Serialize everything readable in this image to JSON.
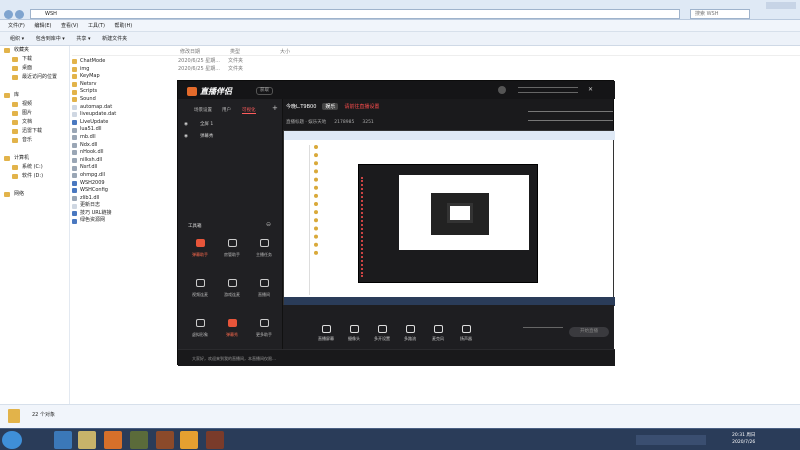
{
  "explorer": {
    "address": "WSH",
    "search_placeholder": "搜索 WSH",
    "menu": [
      "文件(F)",
      "编辑(E)",
      "查看(V)",
      "工具(T)",
      "帮助(H)"
    ],
    "toolbar": [
      "组织 ▾",
      "包含到库中 ▾",
      "共享 ▾",
      "新建文件夹"
    ],
    "columns": {
      "date": "修改日期",
      "type": "类型",
      "size": "大小"
    },
    "sidebar": [
      {
        "label": "收藏夹",
        "indent": 0
      },
      {
        "label": "下载",
        "indent": 1
      },
      {
        "label": "桌面",
        "indent": 1
      },
      {
        "label": "最近访问的位置",
        "indent": 1
      },
      {
        "label": "",
        "indent": 0
      },
      {
        "label": "库",
        "indent": 0
      },
      {
        "label": "视频",
        "indent": 1
      },
      {
        "label": "图片",
        "indent": 1
      },
      {
        "label": "文档",
        "indent": 1
      },
      {
        "label": "迅雷下载",
        "indent": 1
      },
      {
        "label": "音乐",
        "indent": 1
      },
      {
        "label": "",
        "indent": 0
      },
      {
        "label": "计算机",
        "indent": 0
      },
      {
        "label": "系统 (C:)",
        "indent": 1
      },
      {
        "label": "软件 (D:)",
        "indent": 1
      },
      {
        "label": "",
        "indent": 0
      },
      {
        "label": "网络",
        "indent": 0
      }
    ],
    "files": [
      {
        "name": "ChatMode",
        "date": "2020/6/25 星期...",
        "type": "文件夹",
        "icon": "folder"
      },
      {
        "name": "img",
        "date": "2020/6/25 星期...",
        "type": "文件夹",
        "icon": "folder"
      },
      {
        "name": "KeyMap",
        "date": "",
        "type": "",
        "icon": "folder"
      },
      {
        "name": "Netsrv",
        "date": "",
        "type": "",
        "icon": "folder"
      },
      {
        "name": "Scripts",
        "date": "",
        "type": "",
        "icon": "folder"
      },
      {
        "name": "Sound",
        "date": "",
        "type": "",
        "icon": "folder"
      },
      {
        "name": "automap.dat",
        "date": "",
        "type": "",
        "icon": "file"
      },
      {
        "name": "liveupdate.dat",
        "date": "",
        "type": "",
        "icon": "file"
      },
      {
        "name": "LiveUpdate",
        "date": "",
        "type": "",
        "icon": "app"
      },
      {
        "name": "lua51.dll",
        "date": "",
        "type": "",
        "icon": "dll"
      },
      {
        "name": "mb.dll",
        "date": "",
        "type": "",
        "icon": "dll"
      },
      {
        "name": "Ndx.dll",
        "date": "",
        "type": "",
        "icon": "dll"
      },
      {
        "name": "nHook.dll",
        "date": "",
        "type": "",
        "icon": "dll"
      },
      {
        "name": "nilksh.dll",
        "date": "",
        "type": "",
        "icon": "dll"
      },
      {
        "name": "Nsrf.dll",
        "date": "",
        "type": "",
        "icon": "dll"
      },
      {
        "name": "ohmpg.dll",
        "date": "",
        "type": "",
        "icon": "dll"
      },
      {
        "name": "WSH2009",
        "date": "",
        "type": "",
        "icon": "app"
      },
      {
        "name": "WSHConfig",
        "date": "",
        "type": "",
        "icon": "app"
      },
      {
        "name": "zlib1.dll",
        "date": "",
        "type": "",
        "icon": "dll"
      },
      {
        "name": "更新日志",
        "date": "",
        "type": "",
        "icon": "file"
      },
      {
        "name": "技巧 URL链接",
        "date": "",
        "type": "",
        "icon": "app"
      },
      {
        "name": "绿色资源网",
        "date": "",
        "type": "",
        "icon": "app"
      }
    ],
    "status": "22 个对象"
  },
  "app": {
    "brand": "直播伴侣",
    "version": "获取",
    "left_tabs": [
      "场景设置",
      "用户",
      "可视化"
    ],
    "scene_rows": [
      "全屏 1",
      "弹幕秀"
    ],
    "tools_title": "工具箱",
    "tools": [
      {
        "label": "弹幕助手",
        "hot": true
      },
      {
        "label": "房管助手",
        "hot": false
      },
      {
        "label": "主播任务",
        "hot": false
      },
      {
        "label": "视频连麦",
        "hot": false
      },
      {
        "label": "游戏连麦",
        "hot": false
      },
      {
        "label": "直播间",
        "hot": false
      },
      {
        "label": "虚拟形象",
        "hot": false
      },
      {
        "label": "弹幕秀",
        "hot": true
      },
      {
        "label": "更多助手",
        "hot": false
      }
    ],
    "stream_title": "今晚L.T9B00",
    "stream_badge": "娱乐",
    "stream_status": "请前往直播设置",
    "sub_info": [
      "直播标题 · 娱乐天地",
      "2178985",
      "3251"
    ],
    "controls": [
      "直播屏幕",
      "摄像头",
      "多开设置",
      "多路流",
      "麦克风",
      "扬声器"
    ],
    "start_label": "开始直播",
    "chat_hint": "大家好，欢迎来到我的直播间，本直播间仅限…"
  },
  "taskbar": {
    "clock_time": "20:31 周日",
    "clock_date": "2020/7/26"
  }
}
